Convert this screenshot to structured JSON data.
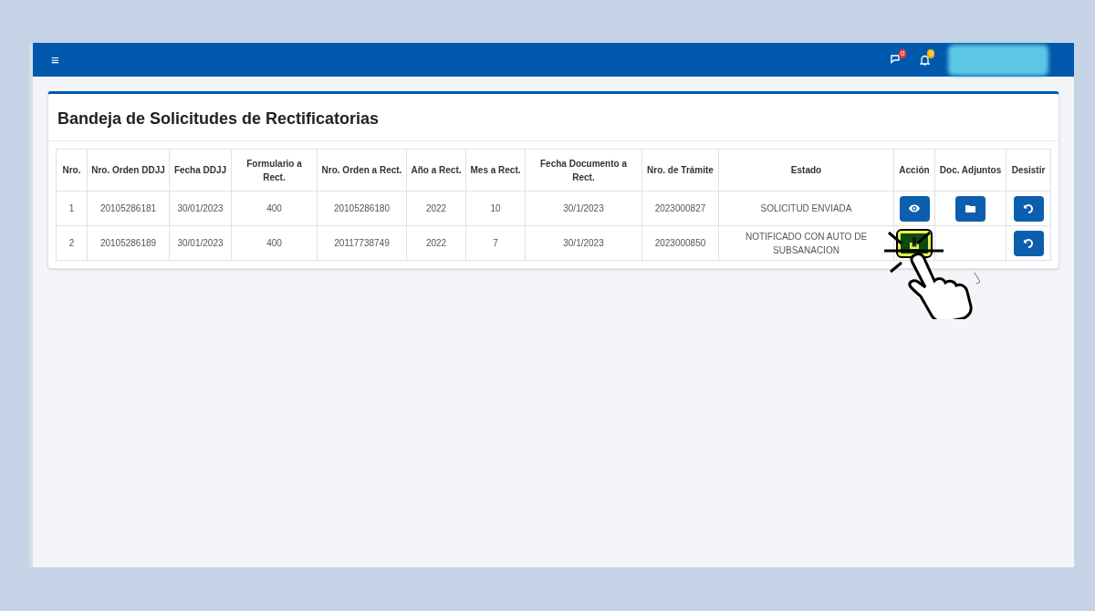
{
  "navbar": {
    "menu_icon": "≡",
    "messages_badge": "0",
    "notifications_badge": "0"
  },
  "card": {
    "title": "Bandeja de Solicitudes de Rectificatorias"
  },
  "table": {
    "columns": [
      "Nro.",
      "Nro. Orden DDJJ",
      "Fecha DDJJ",
      "Formulario a Rect.",
      "Nro. Orden a Rect.",
      "Año a Rect.",
      "Mes a Rect.",
      "Fecha Documento a Rect.",
      "Nro. de Trámite",
      "Estado",
      "Acción",
      "Doc. Adjuntos",
      "Desistir"
    ],
    "rows": [
      {
        "cells": [
          "1",
          "20105286181",
          "30/01/2023",
          "400",
          "20105286180",
          "2022",
          "10",
          "30/1/2023",
          "2023000827",
          "SOLICITUD ENVIADA"
        ],
        "kind": "view",
        "highlighted": false,
        "attachments": true,
        "withdraw": true
      },
      {
        "cells": [
          "2",
          "20105286189",
          "30/01/2023",
          "400",
          "20117738749",
          "2022",
          "7",
          "30/1/2023",
          "2023000850",
          "NOTIFICADO CON AUTO DE SUBSANACION"
        ],
        "kind": "upload",
        "highlighted": true,
        "attachments": false,
        "withdraw": true
      }
    ]
  }
}
